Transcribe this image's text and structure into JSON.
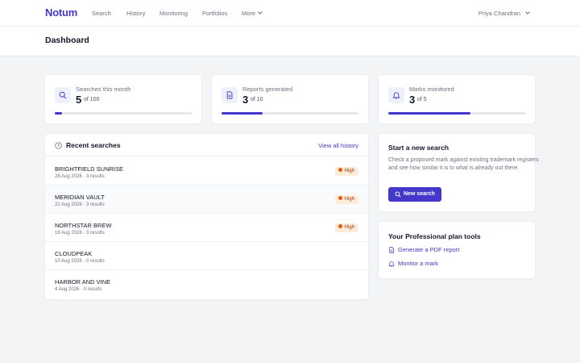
{
  "brand": "Notum",
  "nav": {
    "links": [
      "Search",
      "History",
      "Monitoring",
      "Portfolios"
    ],
    "more": "More",
    "user": "Priya Chandran"
  },
  "page": {
    "title": "Dashboard"
  },
  "stats": [
    {
      "label": "Searches this month",
      "value": "5",
      "of": "of 100",
      "progress": 0.05,
      "icon": "search-icon"
    },
    {
      "label": "Reports generated",
      "value": "3",
      "of": "of 10",
      "progress": 0.3,
      "icon": "document-icon"
    },
    {
      "label": "Marks monitored",
      "value": "3",
      "of": "of 5",
      "progress": 0.6,
      "icon": "bell-icon"
    }
  ],
  "recent": {
    "title": "Recent searches",
    "view_all": "View all history",
    "rows": [
      {
        "name": "BRIGHTFIELD SUNRISE",
        "meta": "28 Aug 2026 · 3 results",
        "badge": "High"
      },
      {
        "name": "MERIDIAN VAULT",
        "meta": "22 Aug 2026 · 3 results",
        "badge": "High"
      },
      {
        "name": "NORTHSTAR BREW",
        "meta": "16 Aug 2026 · 3 results",
        "badge": "High"
      },
      {
        "name": "CLOUDPEAK",
        "meta": "10 Aug 2026 · 0 results",
        "badge": ""
      },
      {
        "name": "HARBOR AND VINE",
        "meta": "4 Aug 2026 · 0 results",
        "badge": ""
      }
    ]
  },
  "new_search": {
    "title": "Start a new search",
    "description": "Check a proposed mark against existing trademark registers and see how similar it is to what is already out there.",
    "button": "New search"
  },
  "tools": {
    "title": "Your Professional plan tools",
    "links": [
      "Generate a PDF report",
      "Monitor a mark"
    ]
  },
  "colors": {
    "accent": "#4338ca",
    "badge_bg": "#fdecd8",
    "badge_dot": "#ea580c"
  }
}
